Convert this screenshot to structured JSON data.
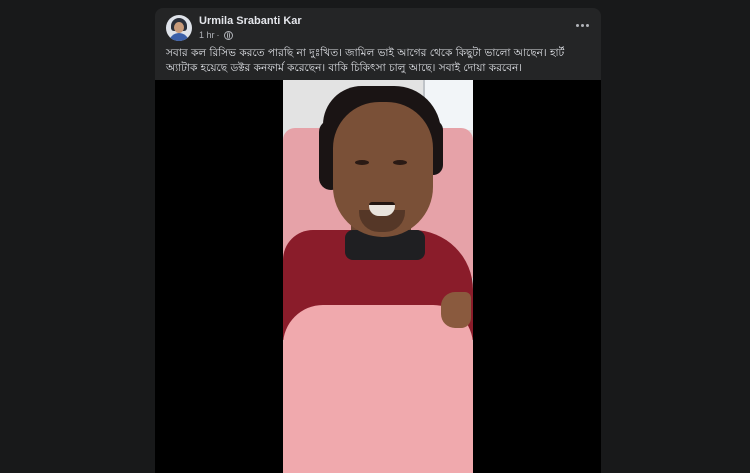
{
  "post": {
    "author": "Urmila Srabanti Kar",
    "timestamp": "1 hr",
    "separator": "·",
    "privacy_icon": "globe-icon",
    "more_icon": "more-horizontal-icon",
    "caption": "সবার কল রিসিভ করতে পারছি না দুঃখিত। জামিল ভাই আগের থেকে কিছুটা ভালো আছেন। হার্ট অ্যাটাক হয়েছে ডক্টর কনফার্ম করেছেন। বাকি চিকিৎসা চালু আছে। সবাই দোয়া করবেন।"
  },
  "colors": {
    "page_bg": "#18191a",
    "card_bg": "#242526",
    "primary_text": "#e4e6eb",
    "secondary_text": "#b0b3b8"
  }
}
